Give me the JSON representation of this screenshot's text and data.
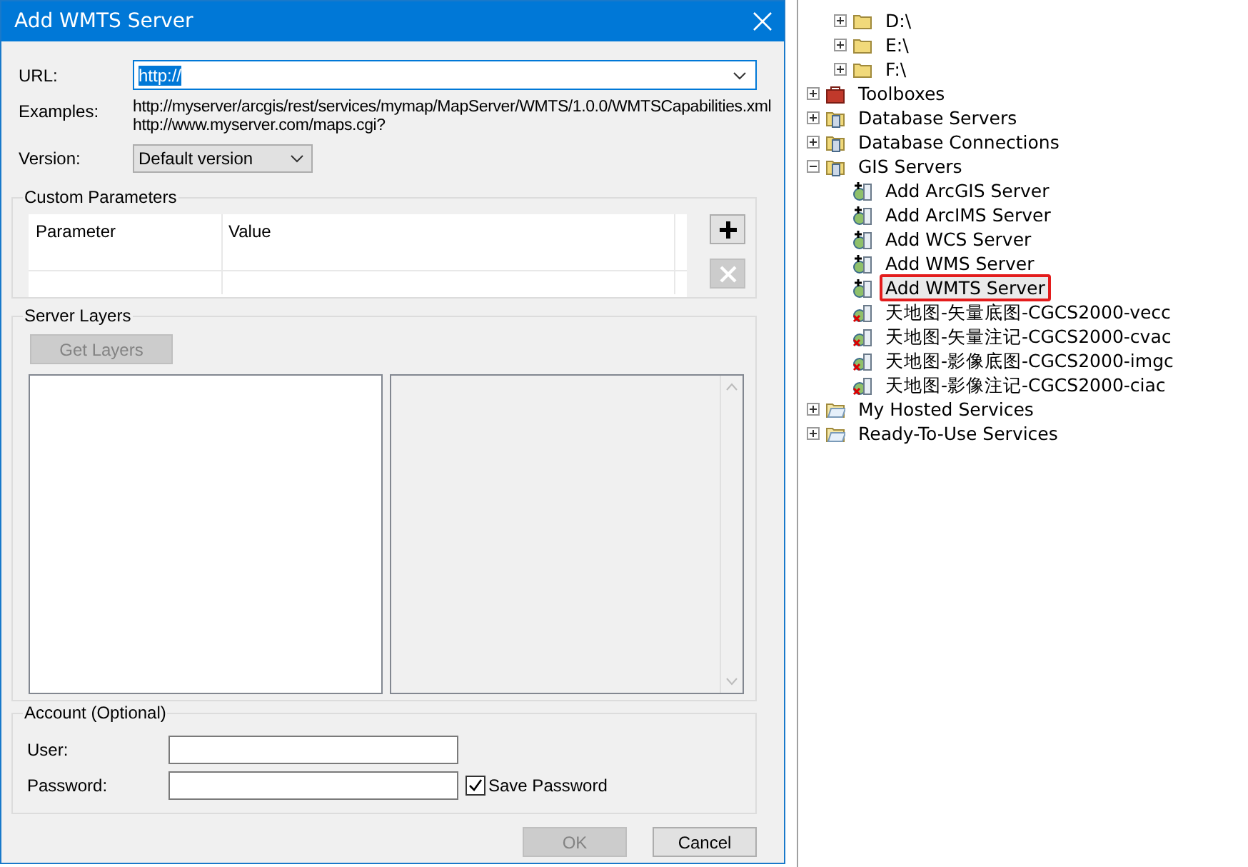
{
  "dialog": {
    "title": "Add WMTS Server",
    "url": {
      "label": "URL:",
      "value": "http://"
    },
    "examples": {
      "label": "Examples:",
      "lines": [
        "http://myserver/arcgis/rest/services/mymap/MapServer/WMTS/1.0.0/WMTSCapabilities.xml",
        "http://www.myserver.com/maps.cgi?"
      ]
    },
    "version": {
      "label": "Version:",
      "value": "Default version"
    },
    "custom_parameters": {
      "title": "Custom Parameters",
      "columns": [
        "Parameter",
        "Value"
      ],
      "add_disabled": false,
      "remove_disabled": true
    },
    "server_layers": {
      "title": "Server Layers",
      "get_layers": {
        "label": "Get Layers",
        "disabled": true
      }
    },
    "account": {
      "title": "Account (Optional)",
      "user_label": "User:",
      "password_label": "Password:",
      "save_password": {
        "label": "Save Password",
        "checked": true
      }
    },
    "buttons": [
      {
        "label": "OK",
        "disabled": true
      },
      {
        "label": "Cancel",
        "disabled": false
      }
    ]
  },
  "tree": [
    {
      "children": [
        {
          "label": "D:\\",
          "kind": "folder",
          "expanded": false
        },
        {
          "label": "E:\\",
          "kind": "folder",
          "expanded": false
        },
        {
          "label": "F:\\",
          "kind": "folder",
          "expanded": false
        }
      ]
    },
    {
      "label": "Toolboxes",
      "kind": "toolbox",
      "expanded": false
    },
    {
      "label": "Database Servers",
      "kind": "server",
      "expanded": false
    },
    {
      "label": "Database Connections",
      "kind": "database",
      "expanded": false
    },
    {
      "label": "GIS Servers",
      "kind": "server",
      "expanded": true,
      "children": [
        {
          "label": "Add ArcGIS Server",
          "kind": "add",
          "selected": false,
          "outlined": false
        },
        {
          "label": "Add ArcIMS Server",
          "kind": "add",
          "selected": false,
          "outlined": false
        },
        {
          "label": "Add WCS Server",
          "kind": "add",
          "selected": false,
          "outlined": false
        },
        {
          "label": "Add WMS Server",
          "kind": "add",
          "selected": false,
          "outlined": false
        },
        {
          "label": "Add WMTS Server",
          "kind": "add",
          "selected": true,
          "outlined": true
        },
        {
          "label": "天地图-矢量底图-CGCS2000-vecc",
          "kind": "service",
          "selected": false,
          "outlined": false
        },
        {
          "label": "天地图-矢量注记-CGCS2000-cvac",
          "kind": "service",
          "selected": false,
          "outlined": false
        },
        {
          "label": "天地图-影像底图-CGCS2000-imgc",
          "kind": "service",
          "selected": false,
          "outlined": false
        },
        {
          "label": "天地图-影像注记-CGCS2000-ciac",
          "kind": "service",
          "selected": false,
          "outlined": false
        }
      ]
    },
    {
      "label": "My Hosted Services",
      "kind": "cloud",
      "expanded": false
    },
    {
      "label": "Ready-To-Use Services",
      "kind": "cloud",
      "expanded": false
    }
  ]
}
